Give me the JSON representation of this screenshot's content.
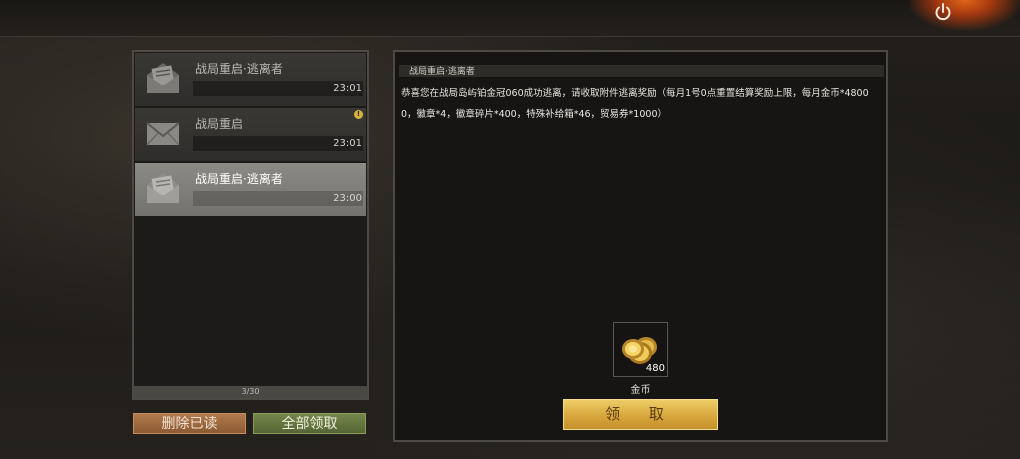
{
  "mail_list": {
    "items": [
      {
        "title": "战局重启·逃离者",
        "time": "23:01",
        "icon": "open-envelope-icon",
        "selected": false,
        "warn": false
      },
      {
        "title": "战局重启",
        "time": "23:01",
        "icon": "envelope-icon",
        "selected": false,
        "warn": true
      },
      {
        "title": "战局重启·逃离者",
        "time": "23:00",
        "icon": "open-envelope-icon",
        "selected": true,
        "warn": false
      }
    ],
    "count": "3/30",
    "warn_glyph": "!"
  },
  "buttons": {
    "delete_read": "删除已读",
    "claim_all": "全部领取",
    "claim": "领 取"
  },
  "detail": {
    "title": "战局重启·逃离者",
    "body": "恭喜您在战局岛屿铂金冠060成功逃离，请收取附件逃离奖励（每月1号0点重置结算奖励上限，每月金币*48000，徽章*4，徽章碎片*400，特殊补给箱*46，贸易券*1000）",
    "reward": {
      "icon": "gold-coins-icon",
      "count": "480",
      "label": "金币"
    }
  },
  "colors": {
    "accent_gold": "#d8a73c",
    "selected_row": "#8c8a85"
  }
}
